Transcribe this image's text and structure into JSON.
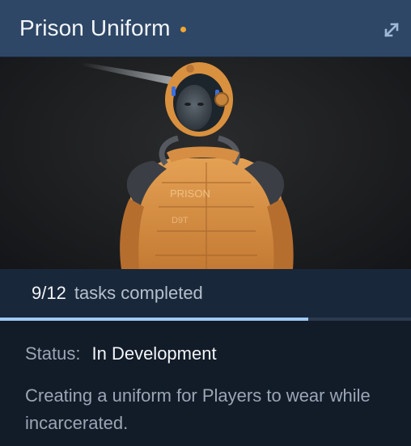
{
  "card": {
    "title": "Prison Uniform",
    "expand_icon": "expand-arrows-icon",
    "image": {
      "alt": "character-in-orange-prison-suit-with-helmet",
      "suit_text_1": "PRISON",
      "suit_text_2": "D9T"
    },
    "progress": {
      "count": "9/12",
      "label": "tasks completed",
      "fraction": 0.75
    },
    "status": {
      "label": "Status:",
      "value": "In Development"
    },
    "description": "Creating a uniform for Players to wear while incarcerated."
  },
  "colors": {
    "header_bg": "#2e4766",
    "status_dot": "#f3a533",
    "progress_fill": "#9fc9f1",
    "progress_track": "#2b3a4e",
    "body_bg": "#121b28"
  }
}
